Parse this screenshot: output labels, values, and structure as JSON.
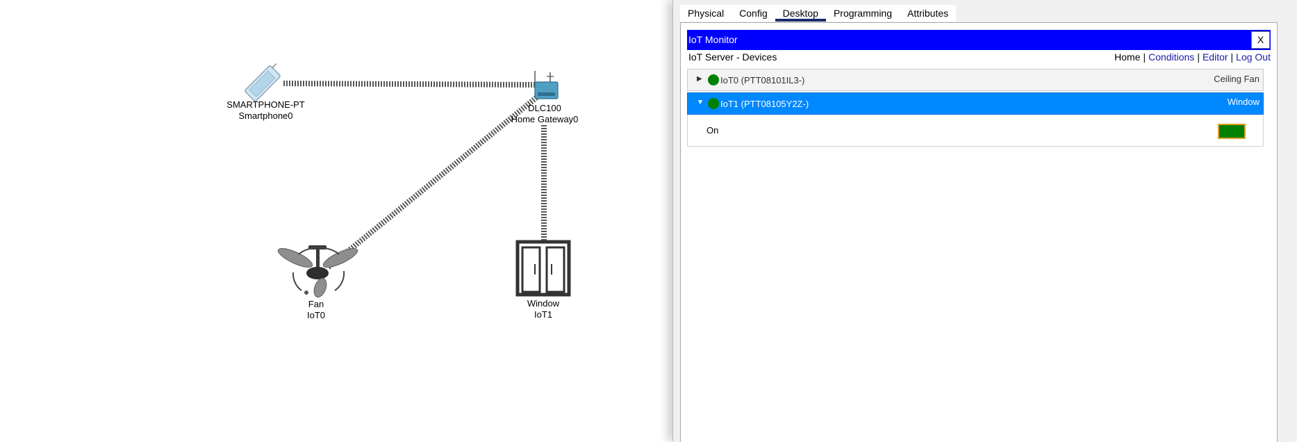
{
  "workspace": {
    "devices": [
      {
        "id": "smartphone",
        "label1": "SMARTPHONE-PT",
        "label2": "Smartphone0"
      },
      {
        "id": "gateway",
        "label1": "DLC100",
        "label2": "Home Gateway0"
      },
      {
        "id": "fan",
        "label1": "Fan",
        "label2": "IoT0"
      },
      {
        "id": "window",
        "label1": "Window",
        "label2": "IoT1"
      }
    ]
  },
  "tabs": [
    {
      "label": "Physical",
      "active": false
    },
    {
      "label": "Config",
      "active": false
    },
    {
      "label": "Desktop",
      "active": true
    },
    {
      "label": "Programming",
      "active": false
    },
    {
      "label": "Attributes",
      "active": false
    }
  ],
  "monitor": {
    "title": "IoT Monitor",
    "close_label": "X",
    "subtitle": "IoT Server - Devices",
    "nav": {
      "home": "Home",
      "sep": "|",
      "conditions": "Conditions",
      "editor": "Editor",
      "logout": "Log Out"
    },
    "devices": [
      {
        "arrow": "▶",
        "name": "IoT0 (PTT08101IL3-)",
        "type": "Ceiling Fan",
        "expanded": false,
        "status_color": "#008000"
      },
      {
        "arrow": "▼",
        "name": "IoT1 (PTT08105Y2Z-)",
        "type": "Window",
        "expanded": true,
        "status_color": "#008000"
      }
    ],
    "detail": {
      "label": "On",
      "state_color": "#008000",
      "state_on": true
    }
  },
  "colors": {
    "titlebar": "#0000ff",
    "selected_row": "#0088ff",
    "status_green": "#008000",
    "active_tab_underline": "#1a2e6e"
  }
}
